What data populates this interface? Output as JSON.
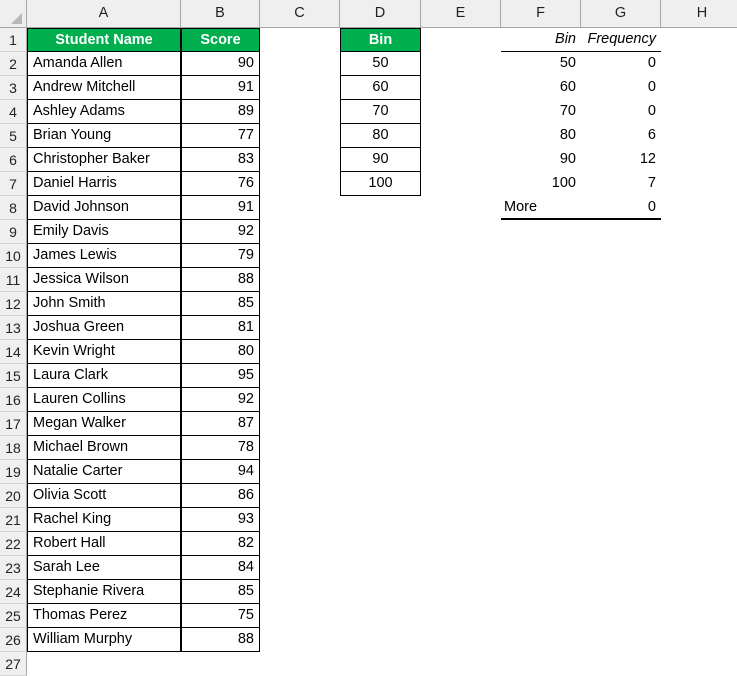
{
  "app": {
    "type": "spreadsheet",
    "select_all_icon": "select-all-triangle-icon"
  },
  "columns": [
    "A",
    "B",
    "C",
    "D",
    "E",
    "F",
    "G",
    "H"
  ],
  "row_numbers": [
    "1",
    "2",
    "3",
    "4",
    "5",
    "6",
    "7",
    "8",
    "9",
    "10",
    "11",
    "12",
    "13",
    "14",
    "15",
    "16",
    "17",
    "18",
    "19",
    "20",
    "21",
    "22",
    "23",
    "24",
    "25",
    "26",
    "27"
  ],
  "colors": {
    "header_green": "#00AE4D",
    "header_text": "#FFFFFF",
    "grid_line": "#D4D4D4",
    "cell_border": "#000000",
    "header_strip": "#EFEFEF"
  },
  "score_table": {
    "headers": {
      "name": "Student Name",
      "score": "Score"
    },
    "rows": [
      {
        "name": "Amanda Allen",
        "score": "90"
      },
      {
        "name": "Andrew Mitchell",
        "score": "91"
      },
      {
        "name": "Ashley Adams",
        "score": "89"
      },
      {
        "name": "Brian Young",
        "score": "77"
      },
      {
        "name": "Christopher Baker",
        "score": "83"
      },
      {
        "name": "Daniel Harris",
        "score": "76"
      },
      {
        "name": "David Johnson",
        "score": "91"
      },
      {
        "name": "Emily Davis",
        "score": "92"
      },
      {
        "name": "James Lewis",
        "score": "79"
      },
      {
        "name": "Jessica Wilson",
        "score": "88"
      },
      {
        "name": "John Smith",
        "score": "85"
      },
      {
        "name": "Joshua Green",
        "score": "81"
      },
      {
        "name": "Kevin Wright",
        "score": "80"
      },
      {
        "name": "Laura Clark",
        "score": "95"
      },
      {
        "name": "Lauren Collins",
        "score": "92"
      },
      {
        "name": "Megan Walker",
        "score": "87"
      },
      {
        "name": "Michael Brown",
        "score": "78"
      },
      {
        "name": "Natalie Carter",
        "score": "94"
      },
      {
        "name": "Olivia Scott",
        "score": "86"
      },
      {
        "name": "Rachel King",
        "score": "93"
      },
      {
        "name": "Robert Hall",
        "score": "82"
      },
      {
        "name": "Sarah Lee",
        "score": "84"
      },
      {
        "name": "Stephanie Rivera",
        "score": "85"
      },
      {
        "name": "Thomas Perez",
        "score": "75"
      },
      {
        "name": "William Murphy",
        "score": "88"
      }
    ]
  },
  "bin_table": {
    "header": "Bin",
    "values": [
      "50",
      "60",
      "70",
      "80",
      "90",
      "100"
    ]
  },
  "frequency_table": {
    "headers": {
      "bin": "Bin",
      "frequency": "Frequency"
    },
    "rows": [
      {
        "bin": "50",
        "frequency": "0"
      },
      {
        "bin": "60",
        "frequency": "0"
      },
      {
        "bin": "70",
        "frequency": "0"
      },
      {
        "bin": "80",
        "frequency": "6"
      },
      {
        "bin": "90",
        "frequency": "12"
      },
      {
        "bin": "100",
        "frequency": "7"
      },
      {
        "bin": "More",
        "frequency": "0"
      }
    ]
  }
}
